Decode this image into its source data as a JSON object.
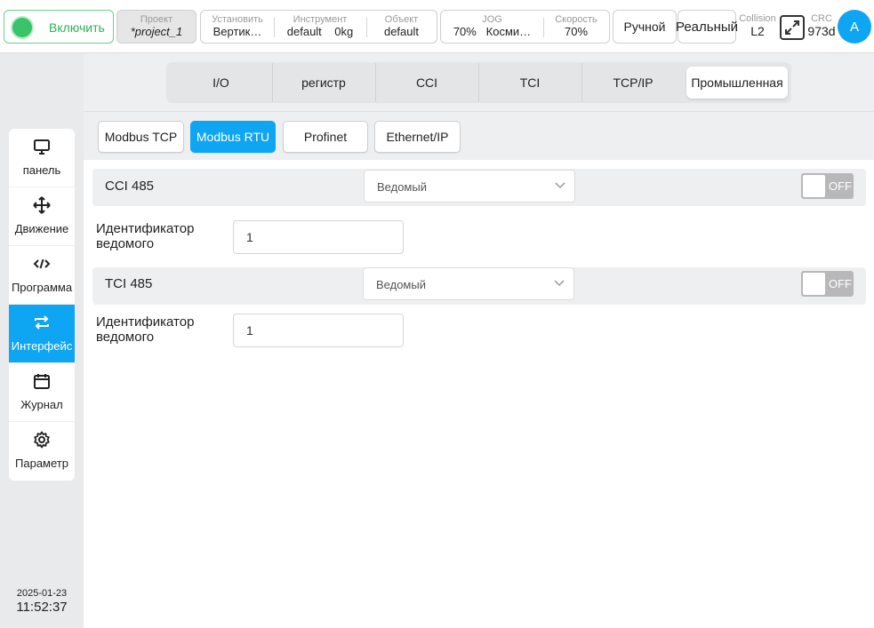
{
  "topbar": {
    "power_label": "Включить",
    "project": {
      "caption": "Проект",
      "value": "*project_1"
    },
    "setup": [
      {
        "caption": "Установить",
        "value": "Вертик…"
      },
      {
        "caption": "Инструмент",
        "value": "default    0kg"
      },
      {
        "caption": "Объект",
        "value": "default"
      }
    ],
    "jog": [
      {
        "caption": "JOG",
        "value": "70%   Косми…"
      },
      {
        "caption": "Скорость",
        "value": "70%"
      }
    ],
    "mode_label": "Ручной",
    "real_label": "Реальный",
    "collision": {
      "caption": "Collision",
      "value": "L2"
    },
    "crc": {
      "caption": "CRC",
      "value": "973d"
    },
    "avatar_letter": "A"
  },
  "sidebar": {
    "items": [
      {
        "label": "панель",
        "icon": "monitor-icon"
      },
      {
        "label": "Движение",
        "icon": "move-icon"
      },
      {
        "label": "Программа",
        "icon": "code-icon"
      },
      {
        "label": "Интерфейс",
        "icon": "swap-icon"
      },
      {
        "label": "Журнал",
        "icon": "calendar-icon"
      },
      {
        "label": "Параметр",
        "icon": "gear-icon"
      }
    ],
    "active_index": 3,
    "date": "2025-01-23",
    "time": "11:52:37"
  },
  "tabs": {
    "items": [
      "I/O",
      "регистр",
      "CCI",
      "TCI",
      "TCP/IP",
      "Промышленная"
    ],
    "active_index": 5
  },
  "subtabs": {
    "items": [
      "Modbus TCP",
      "Modbus RTU",
      "Profinet",
      "Ethernet/IP"
    ],
    "active_index": 1
  },
  "sections": [
    {
      "title": "CCI 485",
      "mode": "Ведомый",
      "toggle": "OFF",
      "id_label_1": "Идентификатор",
      "id_label_2": "ведомого",
      "id_value": "1"
    },
    {
      "title": "TCI 485",
      "mode": "Ведомый",
      "toggle": "OFF",
      "id_label_1": "Идентификатор",
      "id_label_2": "ведомого",
      "id_value": "1"
    }
  ],
  "colors": {
    "accent": "#0ea5f2",
    "power_green": "#39c46a"
  }
}
